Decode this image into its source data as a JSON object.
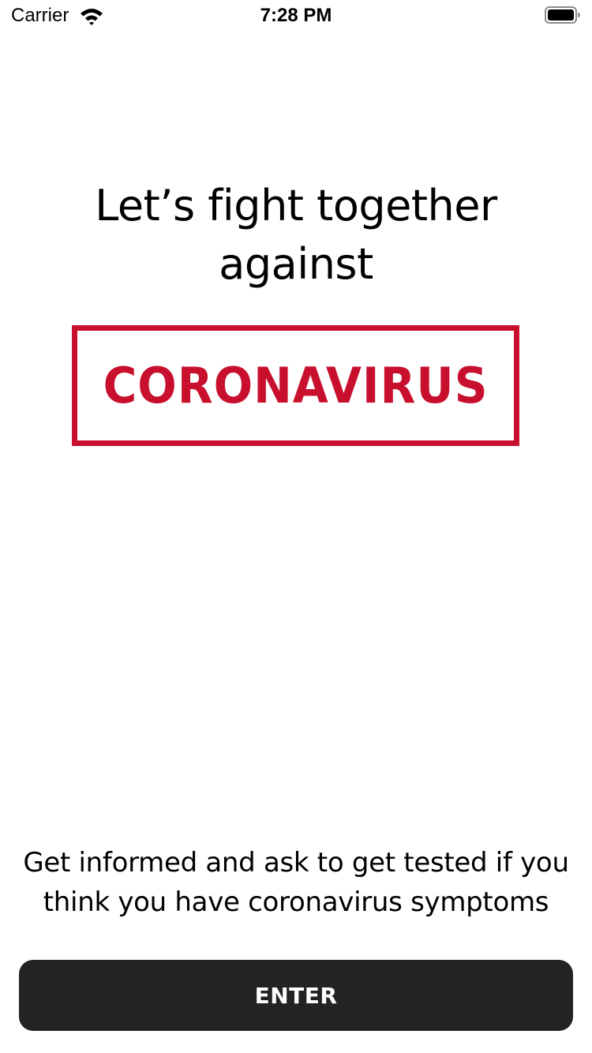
{
  "status_bar": {
    "carrier": "Carrier",
    "time": "7:28 PM",
    "wifi_icon": "wifi-icon",
    "battery_icon": "battery-icon"
  },
  "headline": "Let’s fight together against",
  "logo": {
    "text": "CORONAVIRUS",
    "color": "#c8102e"
  },
  "info": "Get informed and ask to get tested if you think you have coronavirus symptoms",
  "enter_button": {
    "label": "ENTER",
    "background": "#232326",
    "text_color": "#ffffff"
  }
}
